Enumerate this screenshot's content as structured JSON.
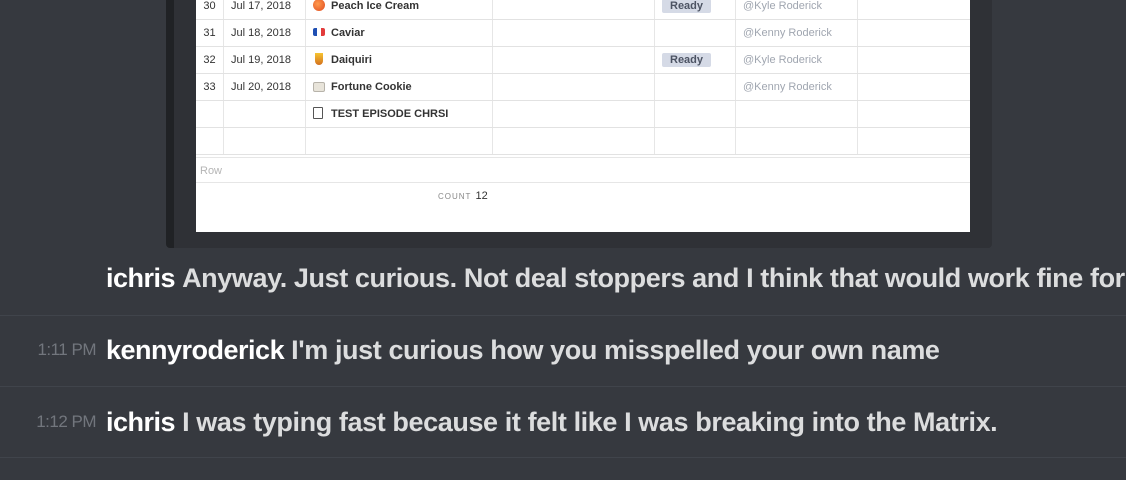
{
  "sheet": {
    "rows": [
      {
        "num": "30",
        "date": "Jul 17, 2018",
        "name": "Peach Ice Cream",
        "icon": "peach-icon",
        "status": "Ready",
        "owner": "@Kyle Roderick"
      },
      {
        "num": "31",
        "date": "Jul 18, 2018",
        "name": "Caviar",
        "icon": "french-flag-icon",
        "status": "",
        "owner": "@Kenny Roderick"
      },
      {
        "num": "32",
        "date": "Jul 19, 2018",
        "name": "Daiquiri",
        "icon": "cocktail-icon",
        "status": "Ready",
        "owner": "@Kyle Roderick"
      },
      {
        "num": "33",
        "date": "Jul 20, 2018",
        "name": "Fortune Cookie",
        "icon": "fortune-cookie-icon",
        "status": "",
        "owner": "@Kenny Roderick"
      },
      {
        "num": "",
        "date": "",
        "name": "TEST EPISODE CHRSI",
        "icon": "document-icon",
        "status": "",
        "owner": ""
      }
    ],
    "row_label": "Row",
    "count_label": "COUNT",
    "count_value": "12"
  },
  "messages": [
    {
      "time": "",
      "user": "ichris",
      "text": "Anyway. Just curious. Not deal stoppers and I think that would work fine for"
    },
    {
      "time": "1:11 PM",
      "user": "kennyroderick",
      "text": "I'm just curious how you misspelled your own name"
    },
    {
      "time": "1:12 PM",
      "user": "ichris",
      "text": "I was typing fast because it felt like I was breaking into the Matrix."
    }
  ]
}
